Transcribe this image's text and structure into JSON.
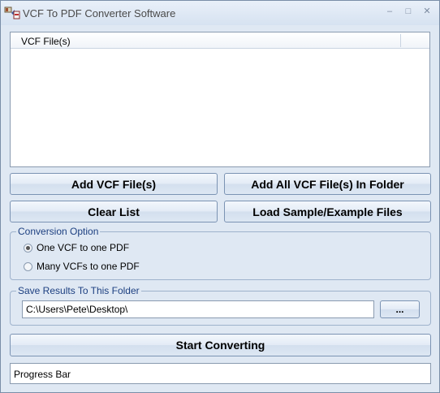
{
  "window": {
    "title": "VCF To PDF Converter Software",
    "controls": {
      "minimize": "–",
      "maximize": "□",
      "close": "✕"
    }
  },
  "file_list": {
    "column_header": "VCF File(s)",
    "rows": []
  },
  "buttons": {
    "add_files": "Add VCF File(s)",
    "add_folder": "Add All VCF File(s) In Folder",
    "clear_list": "Clear List",
    "load_samples": "Load Sample/Example Files",
    "start": "Start Converting"
  },
  "conversion_option": {
    "title": "Conversion Option",
    "options": [
      {
        "label": "One VCF to one PDF",
        "selected": true
      },
      {
        "label": "Many VCFs to one PDF",
        "selected": false
      }
    ]
  },
  "save_folder": {
    "title": "Save Results To This Folder",
    "path": "C:\\Users\\Pete\\Desktop\\",
    "browse_label": "..."
  },
  "progress": {
    "label": "Progress Bar",
    "value": 0
  },
  "colors": {
    "window_bg": "#dfe8f3",
    "group_title": "#1c3f80",
    "border": "#8a9bb0"
  },
  "icons": {
    "app": "vcf-pdf-app-icon",
    "minimize": "minimize-icon",
    "maximize": "maximize-icon",
    "close": "close-icon"
  }
}
